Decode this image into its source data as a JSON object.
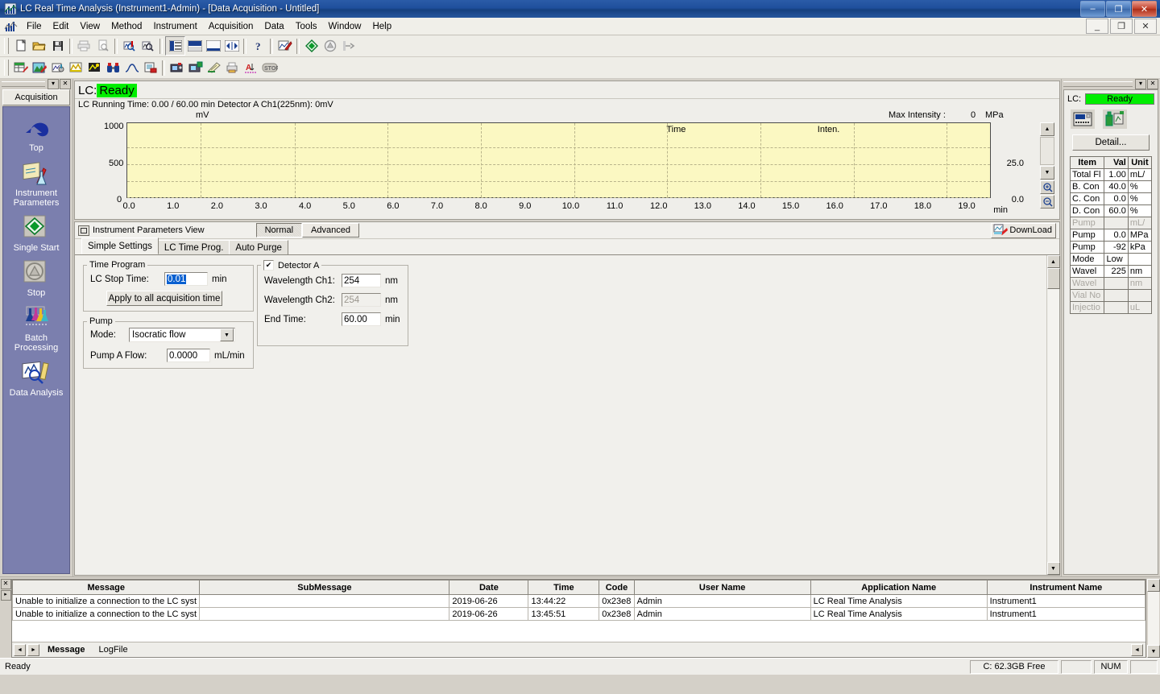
{
  "window": {
    "title": "LC Real Time Analysis (Instrument1-Admin) - [Data Acquisition - Untitled]",
    "app_icon": "lc-chromatogram-icon",
    "minimize": "–",
    "maximize": "❐",
    "close": "✕"
  },
  "menubar": {
    "icon": "lc-chromatogram-icon",
    "items": [
      "File",
      "Edit",
      "View",
      "Method",
      "Instrument",
      "Acquisition",
      "Data",
      "Tools",
      "Window",
      "Help"
    ],
    "mdi": {
      "minimize": "_",
      "restore": "❐",
      "close": "✕"
    }
  },
  "toolbar1": {
    "icons": [
      "new-file-icon",
      "open-folder-icon",
      "save-disk-icon",
      "print-icon",
      "print-preview-icon",
      "data-search-icon",
      "data-search-alt-icon",
      "layout-split-icon",
      "layout-stacked-icon",
      "layout-bottom-icon",
      "layout-expand-icon",
      "help-question-icon",
      "method-edit-icon",
      "single-start-icon",
      "stop-icon",
      "batch-run-icon"
    ]
  },
  "toolbar2": {
    "icons": [
      "table-edit-icon",
      "image-edit-icon",
      "instrument-config-icon",
      "chromatogram-edit-icon",
      "spectrum-edit-icon",
      "binoculars-icon",
      "curve-icon",
      "report-icon",
      "snapshot-icon",
      "snapshot-add-icon",
      "quick-batch-icon",
      "print-batch-icon",
      "auto-label-icon",
      "stop-sign-icon"
    ]
  },
  "sidebar": {
    "caption_dropdown": "▾",
    "caption_close": "✕",
    "tab_label": "Acquisition",
    "items": [
      {
        "icon": "up-arrow-icon",
        "label": "Top"
      },
      {
        "icon": "instrument-parameters-icon",
        "label": "Instrument\nParameters"
      },
      {
        "icon": "single-start-icon",
        "label": "Single Start"
      },
      {
        "icon": "stop-icon",
        "label": "Stop"
      },
      {
        "icon": "batch-processing-icon",
        "label": "Batch\nProcessing"
      },
      {
        "icon": "data-analysis-icon",
        "label": "Data Analysis"
      }
    ]
  },
  "chart_panel": {
    "lc_prefix": "LC:",
    "lc_status": "Ready",
    "status_color": "#00ee00",
    "running_line": "LC Running Time: 0.00 / 60.00 min  Detector A Ch1(225nm): 0mV",
    "max_intensity_label": "Max Intensity :",
    "max_intensity_value": "0",
    "max_intensity_unit": "MPa",
    "legend_time": "Time",
    "legend_inten": "Inten.",
    "scroll_up": "▲",
    "scroll_down": "▼",
    "zoom_in_icon": "zoom-in-icon",
    "zoom_out_icon": "zoom-out-icon"
  },
  "chart_data": {
    "type": "line",
    "title": "",
    "xlabel": "min",
    "ylabel": "mV",
    "y2label": "MPa",
    "xlim": [
      0.0,
      19.6
    ],
    "ylim": [
      0,
      1000
    ],
    "y2lim": [
      0.0,
      37.5
    ],
    "xticks": [
      "0.0",
      "1.0",
      "2.0",
      "3.0",
      "4.0",
      "5.0",
      "6.0",
      "7.0",
      "8.0",
      "9.0",
      "10.0",
      "11.0",
      "12.0",
      "13.0",
      "14.0",
      "15.0",
      "16.0",
      "17.0",
      "18.0",
      "19.0"
    ],
    "yticks": [
      "0",
      "500",
      "1000"
    ],
    "y2ticks": [
      "0.0",
      "25.0"
    ],
    "grid": true,
    "plot_bg": "#fbf8c2",
    "series": [
      {
        "name": "Time",
        "values": []
      },
      {
        "name": "Inten.",
        "values": []
      }
    ],
    "note": "No trace data acquired — empty chromatogram"
  },
  "params": {
    "header_title": "Instrument Parameters View",
    "mode_buttons": [
      {
        "label": "Normal",
        "selected": true
      },
      {
        "label": "Advanced",
        "selected": false
      }
    ],
    "download_label": "DownLoad",
    "download_icon": "download-icon",
    "tabs": [
      {
        "label": "Simple Settings",
        "active": true
      },
      {
        "label": "LC Time Prog.",
        "active": false
      },
      {
        "label": "Auto Purge",
        "active": false
      }
    ],
    "time_program": {
      "legend": "Time Program",
      "stop_time_label": "LC Stop Time:",
      "stop_time_value": "0.01",
      "stop_time_unit": "min",
      "apply_button": "Apply to all acquisition time"
    },
    "pump": {
      "legend": "Pump",
      "mode_label": "Mode:",
      "mode_value": "Isocratic flow",
      "mode_arrow": "▼",
      "flow_label": "Pump A Flow:",
      "flow_value": "0.0000",
      "flow_unit": "mL/min"
    },
    "detector": {
      "legend": "Detector A",
      "checked": true,
      "check_glyph": "✔",
      "wl1_label": "Wavelength Ch1:",
      "wl1_value": "254",
      "wl1_unit": "nm",
      "wl2_label": "Wavelength Ch2:",
      "wl2_value": "254",
      "wl2_unit": "nm",
      "wl2_disabled": true,
      "end_time_label": "End Time:",
      "end_time_value": "60.00",
      "end_time_unit": "min"
    },
    "scroll_up": "▲",
    "scroll_down": "▼"
  },
  "right_panel": {
    "caption_dropdown": "▾",
    "caption_close": "✕",
    "lc_label": "LC:",
    "lc_status": "Ready",
    "icons": [
      "lc-controller-icon",
      "pump-module-icon"
    ],
    "detail_button": "Detail...",
    "table": {
      "headers": [
        "Item",
        "Val",
        "Unit"
      ],
      "rows": [
        {
          "item": "Total Fl",
          "val": "1.00",
          "unit": "mL/",
          "disabled": false
        },
        {
          "item": "B. Con",
          "val": "40.0",
          "unit": "%",
          "disabled": false
        },
        {
          "item": "C. Con",
          "val": "0.0",
          "unit": "%",
          "disabled": false
        },
        {
          "item": "D. Con",
          "val": "60.0",
          "unit": "%",
          "disabled": false
        },
        {
          "item": "Pump",
          "val": "",
          "unit": "mL/",
          "disabled": true
        },
        {
          "item": "Pump",
          "val": "0.0",
          "unit": "MPa",
          "disabled": false
        },
        {
          "item": "Pump",
          "val": "-92",
          "unit": "kPa",
          "disabled": false
        },
        {
          "item": "Mode",
          "val": "Low",
          "unit": "",
          "disabled": false
        },
        {
          "item": "Wavel",
          "val": "225",
          "unit": "nm",
          "disabled": false
        },
        {
          "item": "Wavel",
          "val": "",
          "unit": "nm",
          "disabled": true
        },
        {
          "item": "Vial No",
          "val": "",
          "unit": "",
          "disabled": true
        },
        {
          "item": "Injectio",
          "val": "",
          "unit": "uL",
          "disabled": true
        }
      ]
    }
  },
  "log_panel": {
    "close_glyph": "✕",
    "expand_glyph": "▸",
    "headers": [
      "Message",
      "SubMessage",
      "Date",
      "Time",
      "Code",
      "User Name",
      "Application Name",
      "Instrument Name"
    ],
    "rows": [
      {
        "message": "Unable to initialize a connection to the LC syst",
        "submessage": "",
        "date": "2019-06-26",
        "time": "13:44:22",
        "code": "0x23e8",
        "user": "Admin",
        "application": "LC Real Time Analysis",
        "instrument": "Instrument1"
      },
      {
        "message": "Unable to initialize a connection to the LC syst",
        "submessage": "",
        "date": "2019-06-26",
        "time": "13:45:51",
        "code": "0x23e8",
        "user": "Admin",
        "application": "LC Real Time Analysis",
        "instrument": "Instrument1"
      }
    ],
    "tabs": [
      {
        "label": "Message",
        "active": true
      },
      {
        "label": "LogFile",
        "active": false
      }
    ],
    "nav_prev": "◄",
    "nav_next": "►",
    "scroll_up": "▲",
    "scroll_down": "▼",
    "scroll_right": "►",
    "scroll_left": "◄"
  },
  "statusbar": {
    "message": "Ready",
    "disk": "C: 62.3GB Free",
    "numlock": "NUM"
  }
}
